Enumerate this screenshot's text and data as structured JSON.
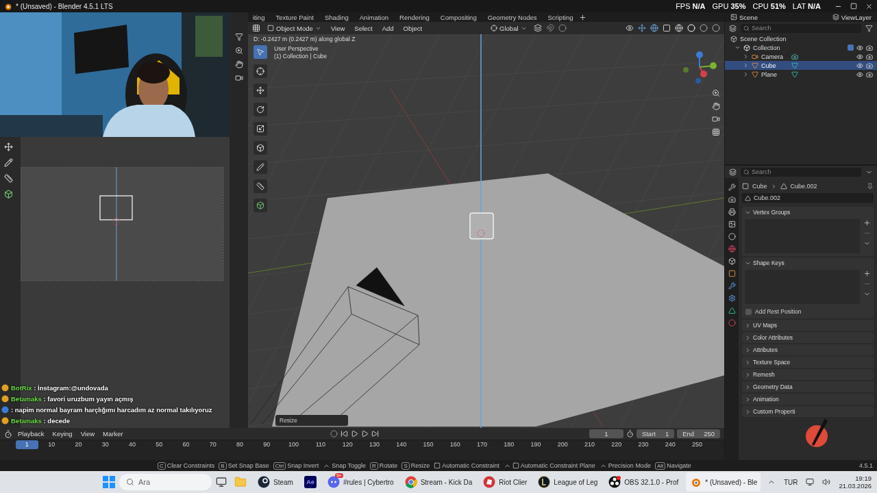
{
  "window": {
    "title": "* (Unsaved) - Blender 4.5.1 LTS"
  },
  "stats": [
    {
      "label": "FPS",
      "value": "N/A"
    },
    {
      "label": "GPU",
      "value": "35%"
    },
    {
      "label": "CPU",
      "value": "51%"
    },
    {
      "label": "LAT",
      "value": "N/A"
    }
  ],
  "workspace_tabs": [
    {
      "label": "iting",
      "selected": false
    },
    {
      "label": "Texture Paint",
      "selected": false
    },
    {
      "label": "Shading",
      "selected": false
    },
    {
      "label": "Animation",
      "selected": false
    },
    {
      "label": "Rendering",
      "selected": false
    },
    {
      "label": "Compositing",
      "selected": false
    },
    {
      "label": "Geometry Nodes",
      "selected": false
    },
    {
      "label": "Scripting",
      "selected": false
    }
  ],
  "viewport_header": {
    "mode": "Object Mode",
    "menus": [
      "View",
      "Select",
      "Add",
      "Object"
    ],
    "orientation": "Global"
  },
  "viewport": {
    "operator_info": "D: -0.2427 m (0.2427 m) along global Z",
    "view_name": "User Perspective",
    "collection_info": "(1) Collection | Cube",
    "last_operator": "Resize"
  },
  "outliner": {
    "scene": "Scene",
    "view_layer": "ViewLayer",
    "search_placeholder": "Search",
    "root": "Scene Collection",
    "collection": {
      "name": "Collection",
      "expanded": true,
      "checked": true,
      "children": [
        {
          "name": "Camera",
          "kind": "camera",
          "selected": false
        },
        {
          "name": "Cube",
          "kind": "mesh",
          "selected": true
        },
        {
          "name": "Plane",
          "kind": "mesh",
          "selected": false
        }
      ]
    }
  },
  "properties": {
    "search_placeholder": "Search",
    "breadcrumb": [
      "Cube",
      "Cube.002"
    ],
    "mesh_name": "Cube.002",
    "panels": [
      {
        "title": "Vertex Groups",
        "expanded": true
      },
      {
        "title": "Shape Keys",
        "expanded": true,
        "checkbox": {
          "label": "Add Rest Position",
          "checked": false
        }
      },
      {
        "title": "UV Maps",
        "expanded": false
      },
      {
        "title": "Color Attributes",
        "expanded": false
      },
      {
        "title": "Attributes",
        "expanded": false
      },
      {
        "title": "Texture Space",
        "expanded": false
      },
      {
        "title": "Remesh",
        "expanded": false
      },
      {
        "title": "Geometry Data",
        "expanded": false
      },
      {
        "title": "Animation",
        "expanded": false
      },
      {
        "title": "Custom Properti",
        "expanded": false
      }
    ]
  },
  "timeline": {
    "menus": [
      "Playback",
      "Keying",
      "View",
      "Marker"
    ],
    "current_frame": "1",
    "start": {
      "label": "Start",
      "value": "1"
    },
    "end": {
      "label": "End",
      "value": "250"
    },
    "ruler": [
      "1",
      "10",
      "20",
      "30",
      "40",
      "50",
      "60",
      "70",
      "80",
      "90",
      "100",
      "110",
      "120",
      "130",
      "140",
      "150",
      "160",
      "170",
      "180",
      "190",
      "200",
      "210",
      "220",
      "230",
      "240",
      "250"
    ]
  },
  "status_bar": {
    "hints": [
      {
        "kind": "key",
        "key": "C",
        "label": "Clear Constraints"
      },
      {
        "kind": "key",
        "key": "B",
        "label": "Set Snap Base"
      },
      {
        "kind": "key",
        "key": "Ctrl",
        "label": "Snap Invert"
      },
      {
        "kind": "shift",
        "label": "Snap Toggle"
      },
      {
        "kind": "key",
        "key": "R",
        "label": "Rotate"
      },
      {
        "kind": "key",
        "key": "S",
        "label": "Resize"
      },
      {
        "kind": "mouse",
        "label": "Automatic Constraint"
      },
      {
        "kind": "shift-mouse",
        "label": "Automatic Constraint Plane"
      },
      {
        "kind": "shift",
        "label": "Precision Mode"
      },
      {
        "kind": "key",
        "key": "Alt",
        "label": "Navigate"
      }
    ],
    "version": "4.5.1"
  },
  "chat": [
    {
      "user": "BotRix",
      "message": " : İnstagram:@undovada"
    },
    {
      "user": "Betamaks",
      "message": " : favori uruzbum yayın açmış"
    },
    {
      "message": " : napim normal bayram harçlığımı harcadım az normal takılıyoruz"
    },
    {
      "user": "Betamaks",
      "message": " : decede"
    }
  ],
  "taskbar": {
    "search_placeholder": "Ara",
    "apps": [
      {
        "kind": "explorer"
      },
      {
        "kind": "steam",
        "label": "Steam"
      },
      {
        "kind": "ae",
        "icon_text": "Ae"
      },
      {
        "kind": "discord",
        "label": "#rules | Cybertro",
        "badge": "9+"
      },
      {
        "kind": "chrome",
        "label": "Stream - Kick Da"
      },
      {
        "kind": "riot",
        "label": "Riot Clier"
      },
      {
        "kind": "league",
        "label": "League of Leg"
      },
      {
        "kind": "obs",
        "label": "OBS 32.1.0 - Prof"
      },
      {
        "kind": "blender",
        "label": "* (Unsaved) - Ble"
      }
    ],
    "tray": {
      "language": "TUR",
      "time": "19:19",
      "date": "21.03.2026"
    }
  }
}
